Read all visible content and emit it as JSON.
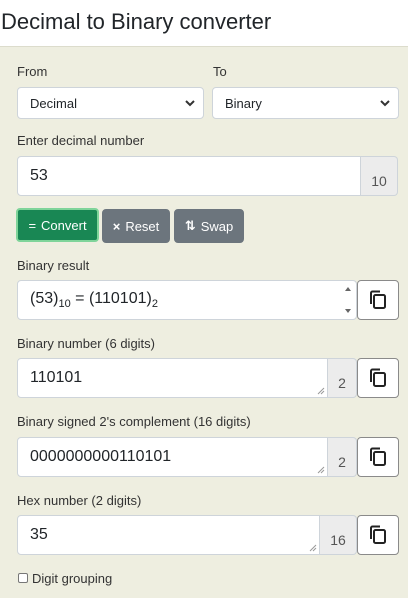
{
  "title": "Decimal to Binary converter",
  "from": {
    "label": "From",
    "value": "Decimal"
  },
  "to": {
    "label": "To",
    "value": "Binary"
  },
  "input": {
    "label": "Enter decimal number",
    "value": "53",
    "base": "10"
  },
  "buttons": {
    "convert": {
      "icon": "=",
      "label": "Convert"
    },
    "reset": {
      "icon": "×",
      "label": "Reset"
    },
    "swap": {
      "icon": "⇅",
      "label": "Swap"
    }
  },
  "result": {
    "label": "Binary result",
    "left_value": "53",
    "left_base": "10",
    "equals": "=",
    "right_value": "110101",
    "right_base": "2"
  },
  "binary_number": {
    "label": "Binary number (6 digits)",
    "value": "110101",
    "base": "2"
  },
  "signed": {
    "label": "Binary signed 2's complement (16 digits)",
    "value": "0000000000110101",
    "base": "2"
  },
  "hex": {
    "label": "Hex number (2 digits)",
    "value": "35",
    "base": "16"
  },
  "digit_grouping": {
    "label": "Digit grouping",
    "checked": false
  },
  "colors": {
    "panel": "#eeeee0",
    "convert": "#198754",
    "secondary": "#6c757d"
  }
}
